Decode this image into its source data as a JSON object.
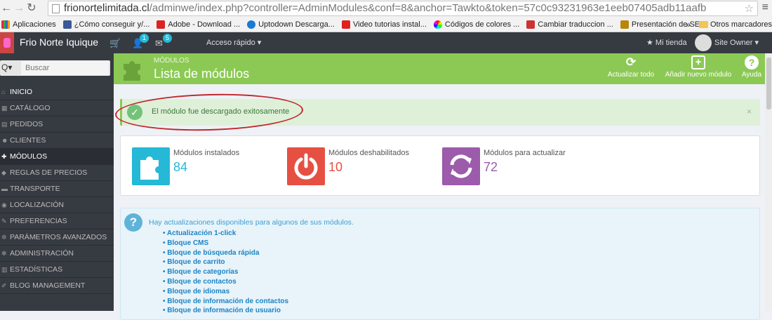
{
  "browser": {
    "url_host": "frionortelimitada.cl",
    "url_path": "/adminwe/index.php?controller=AdminModules&conf=8&anchor=Tawkto&token=57c0c93231963e1eeb07405adb11aafb",
    "bookmarks": [
      {
        "label": "Aplicaciones",
        "color": "#e24"
      },
      {
        "label": "¿Cómo conseguir y/...",
        "color": "#3b5998"
      },
      {
        "label": "Adobe - Download ...",
        "color": "#d22"
      },
      {
        "label": "Uptodown Descarga...",
        "color": "#1a7ad6"
      },
      {
        "label": "Video tutorias instal...",
        "color": "#e02020"
      },
      {
        "label": "Códigos de colores ...",
        "color": "#f7a200"
      },
      {
        "label": "Cambiar traduccion ...",
        "color": "#c33"
      },
      {
        "label": "Presentación de SE...",
        "color": "#b8860b"
      }
    ],
    "bookmarks_overflow": "»",
    "other_bookmarks": "Otros marcadores"
  },
  "topbar": {
    "shop_name": "Frio Norte Iquique",
    "badge_customers": "1",
    "badge_messages": "5",
    "quick_access": "Acceso rápido ▾",
    "my_store": "Mi tienda",
    "owner": "Site Owner ▾"
  },
  "sidebar": {
    "search_placeholder": "Buscar",
    "items": [
      {
        "label": "INICIO"
      },
      {
        "label": "CATÁLOGO"
      },
      {
        "label": "PEDIDOS"
      },
      {
        "label": "CLIENTES"
      },
      {
        "label": "MÓDULOS"
      },
      {
        "label": "REGLAS DE PRECIOS"
      },
      {
        "label": "TRANSPORTE"
      },
      {
        "label": "LOCALIZACIÓN"
      },
      {
        "label": "PREFERENCIAS"
      },
      {
        "label": "PARÁMETROS AVANZADOS"
      },
      {
        "label": "ADMINISTRACIÓN"
      },
      {
        "label": "ESTADÍSTICAS"
      },
      {
        "label": "BLOG MANAGEMENT"
      }
    ]
  },
  "header": {
    "breadcrumb": "MÓDULOS",
    "title": "Lista de módulos",
    "buttons": [
      {
        "label": "Actualizar todo"
      },
      {
        "label": "Añadir nuevo módulo"
      },
      {
        "label": "Ayuda"
      }
    ]
  },
  "alert": {
    "message": "El módulo fue descargado exitosamente",
    "close": "×"
  },
  "stats": [
    {
      "label": "Módulos instalados",
      "value": "84",
      "color": "#25b9d7"
    },
    {
      "label": "Módulos deshabilitados",
      "value": "10",
      "color": "#e65043"
    },
    {
      "label": "Módulos para actualizar",
      "value": "72",
      "color": "#9c5bab"
    }
  ],
  "updates": {
    "lead": "Hay actualizaciones disponibles para algunos de sus módulos.",
    "modules": [
      "Actualización 1-click",
      "Bloque CMS",
      "Bloque de búsqueda rápida",
      "Bloque de carrito",
      "Bloque de categorías",
      "Bloque de contactos",
      "Bloque de idiomas",
      "Bloque de información de contactos",
      "Bloque de información de usuario"
    ]
  }
}
